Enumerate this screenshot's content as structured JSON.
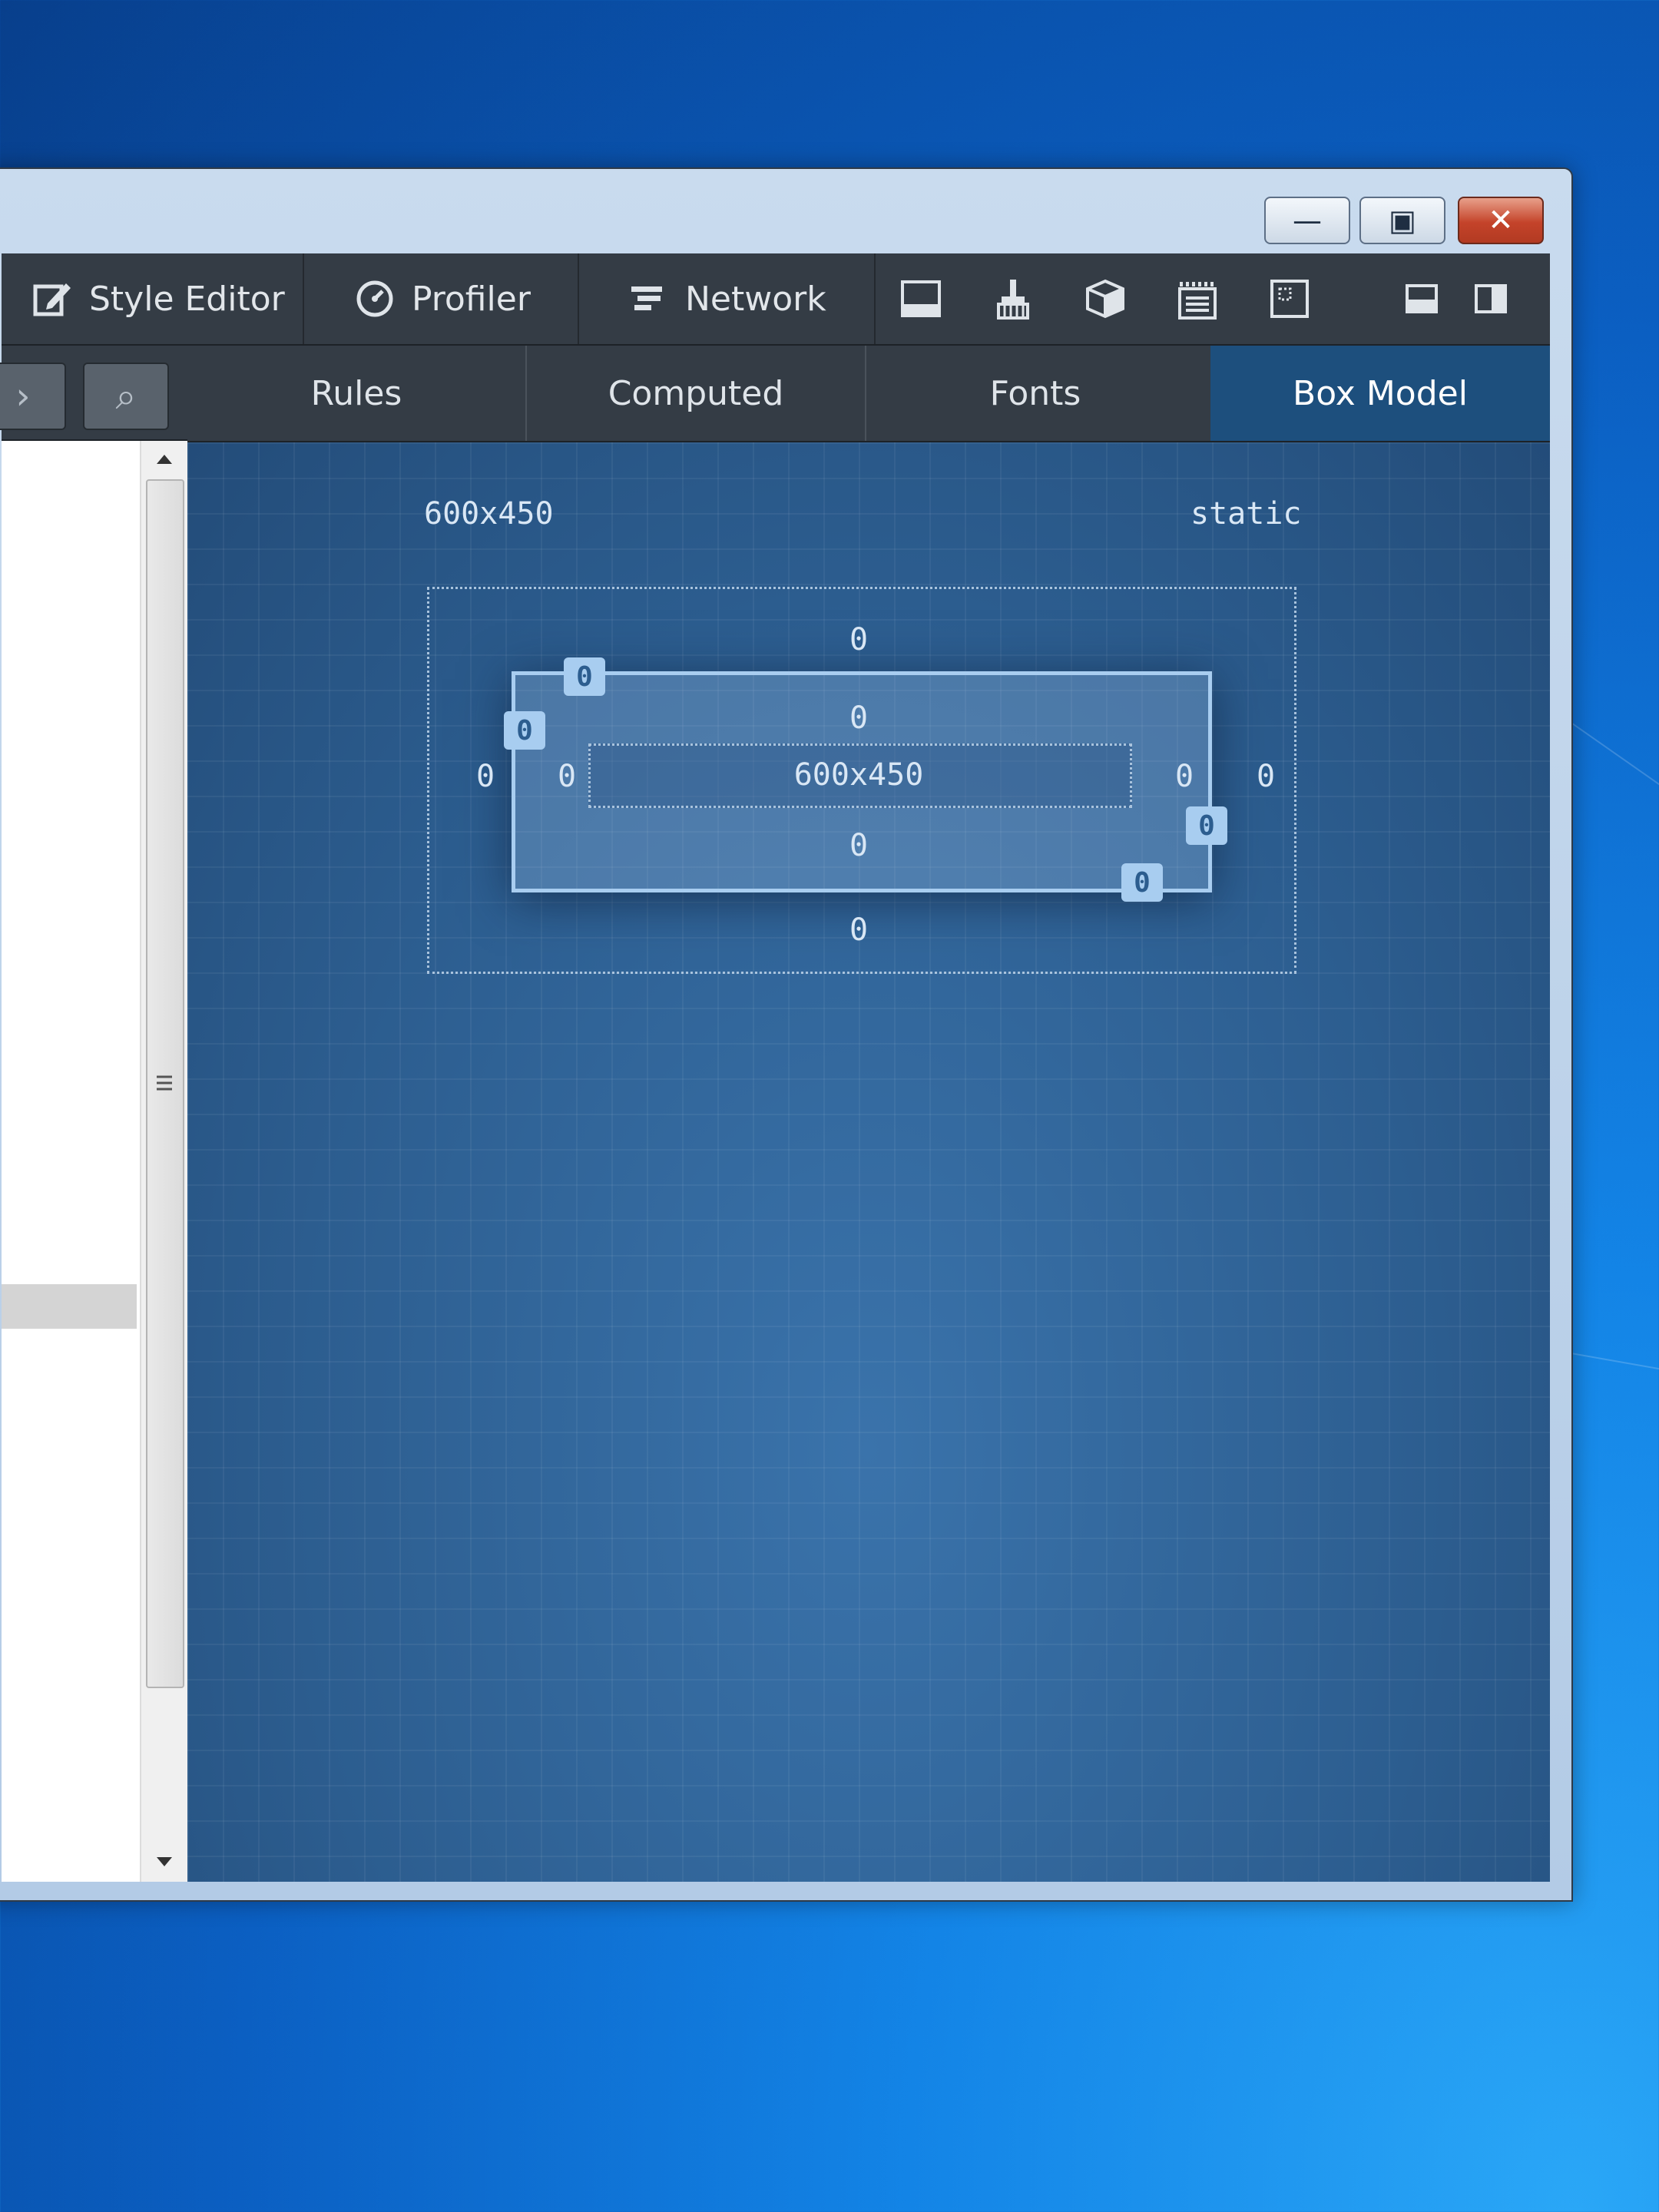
{
  "window": {
    "controls": {
      "minimize": "—",
      "maximize": "▣",
      "close": "✕"
    }
  },
  "toolbar": {
    "tabs": [
      {
        "label": "Style Editor",
        "icon": "style-editor-icon"
      },
      {
        "label": "Profiler",
        "icon": "profiler-icon"
      },
      {
        "label": "Network",
        "icon": "network-icon"
      }
    ],
    "icons": [
      "split-console-icon",
      "paintbrush-icon",
      "3d-view-icon",
      "scratchpad-icon",
      "responsive-icon",
      "dock-bottom-icon",
      "dock-side-icon"
    ]
  },
  "left_panel": {
    "next_glyph": "›",
    "search_glyph": "⌕"
  },
  "sidebar": {
    "tabs": [
      "Rules",
      "Computed",
      "Fonts",
      "Box Model"
    ],
    "active_tab": "Box Model"
  },
  "box_model": {
    "dimensions": "600x450",
    "position": "static",
    "margin": {
      "top": "0",
      "right": "0",
      "bottom": "0",
      "left": "0"
    },
    "border": {
      "top": "0",
      "right": "0",
      "bottom": "0",
      "left": "0"
    },
    "padding": {
      "top": "0",
      "right": "0",
      "bottom": "0",
      "left": "0"
    },
    "content": "600x450"
  },
  "colors": {
    "accent": "#1d4f7d",
    "box_model_bg": "#2c5d8f",
    "toolbar_bg": "#343c45"
  }
}
